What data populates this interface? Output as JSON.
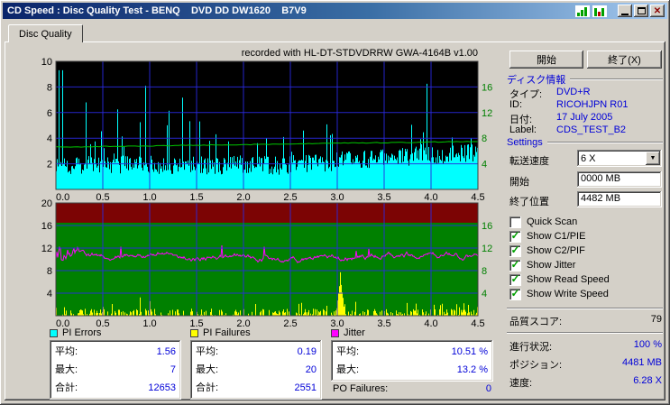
{
  "window": {
    "title": "CD Speed : Disc Quality Test - BENQ    DVD DD DW1620    B7V9",
    "controls": {
      "close": "✕"
    }
  },
  "tab": {
    "label": "Disc Quality"
  },
  "chart": {
    "recorded_with": "recorded with HL-DT-STDVDRRW GWA-4164B v1.00"
  },
  "chart_data": [
    {
      "type": "area",
      "name": "pi-errors-and-speed",
      "background": "#000000",
      "grid_color": "#2a2ae0",
      "x_ticks": [
        "0.0",
        "0.5",
        "1.0",
        "1.5",
        "2.0",
        "2.5",
        "3.0",
        "3.5",
        "4.0",
        "4.5"
      ],
      "x_range_gb": [
        0,
        4.5
      ],
      "y_left_ticks": [
        10,
        8,
        6,
        4,
        2
      ],
      "y_left_range": [
        0,
        10
      ],
      "y_right_ticks": [
        16,
        12,
        8,
        4
      ],
      "y_right_range": [
        0,
        20
      ],
      "y_right_color": "#008000",
      "series": [
        {
          "name": "PI Errors",
          "color": "#00ffff",
          "average": 1.56,
          "maximum": 7,
          "total": 12653
        },
        {
          "name": "Speed",
          "color": "#00c800",
          "start_x": 6.6,
          "end_x": 7.5,
          "reported_speed_x": 6.28
        }
      ]
    },
    {
      "type": "line",
      "name": "jitter-and-pi-failures",
      "background": "#008000",
      "danger_band_color": "#7c0404",
      "danger_band_from": 16.5,
      "grid_color": "#2a2ae0",
      "x_ticks": [
        "0.0",
        "0.5",
        "1.0",
        "1.5",
        "2.0",
        "2.5",
        "3.0",
        "3.5",
        "4.0",
        "4.5"
      ],
      "x_range_gb": [
        0,
        4.5
      ],
      "y_left_ticks": [
        20,
        16,
        12,
        8,
        4
      ],
      "y_left_range": [
        0,
        20
      ],
      "y_right_ticks": [
        16,
        12,
        8,
        4
      ],
      "y_right_range": [
        0,
        20
      ],
      "y_right_color": "#008000",
      "series": [
        {
          "name": "Jitter",
          "color": "#ff00ff",
          "average_pct": 10.51,
          "maximum_pct": 13.2
        },
        {
          "name": "PI Failures",
          "color": "#ffff00",
          "average": 0.19,
          "maximum": 20,
          "total": 2551,
          "spike_position_gb": 3.03
        },
        {
          "name": "PO Failures",
          "total": 0
        }
      ]
    }
  ],
  "legend": {
    "panels": [
      {
        "title": "PI Errors",
        "color": "#00ffff",
        "rows": [
          {
            "label": "平均:",
            "value": "1.56"
          },
          {
            "label": "最大:",
            "value": "7"
          },
          {
            "label": "合計:",
            "value": "12653"
          }
        ]
      },
      {
        "title": "PI Failures",
        "color": "#ffff00",
        "rows": [
          {
            "label": "平均:",
            "value": "0.19"
          },
          {
            "label": "最大:",
            "value": "20"
          },
          {
            "label": "合計:",
            "value": "2551"
          }
        ]
      },
      {
        "title": "Jitter",
        "color": "#ff00ff",
        "rows": [
          {
            "label": "平均:",
            "value": "10.51 %"
          },
          {
            "label": "最大:",
            "value": "13.2 %"
          }
        ],
        "extra": {
          "label": "PO Failures:",
          "value": "0"
        }
      }
    ]
  },
  "sidebar": {
    "start_button": "開始",
    "exit_button": "終了(X)",
    "disc_info": {
      "header": "ディスク情報",
      "rows": [
        {
          "label": "タイプ:",
          "value": "DVD+R"
        },
        {
          "label": "ID:",
          "value": "RICOHJPN R01"
        },
        {
          "label": "日付:",
          "value": "17 July 2005"
        },
        {
          "label": "Label:",
          "value": "CDS_TEST_B2"
        }
      ]
    },
    "settings": {
      "header": "Settings",
      "speed_label": "転送速度",
      "speed_value": "6 X",
      "start_label": "開始",
      "start_value": "0000 MB",
      "end_label": "終了位置",
      "end_value": "4482 MB",
      "checkboxes": [
        {
          "label": "Quick Scan",
          "mark": ""
        },
        {
          "label": "Show C1/PIE",
          "mark": "✓"
        },
        {
          "label": "Show C2/PIF",
          "mark": "✓"
        },
        {
          "label": "Show Jitter",
          "mark": "✓"
        },
        {
          "label": "Show Read Speed",
          "mark": "✓"
        },
        {
          "label": "Show Write Speed",
          "mark": "✓"
        }
      ]
    },
    "score": {
      "label": "品質スコア:",
      "value": "79"
    },
    "status": [
      {
        "label": "進行状況:",
        "value": "100 %"
      },
      {
        "label": "ポジション:",
        "value": "4481 MB"
      },
      {
        "label": "速度:",
        "value": "6.28 X"
      }
    ]
  }
}
